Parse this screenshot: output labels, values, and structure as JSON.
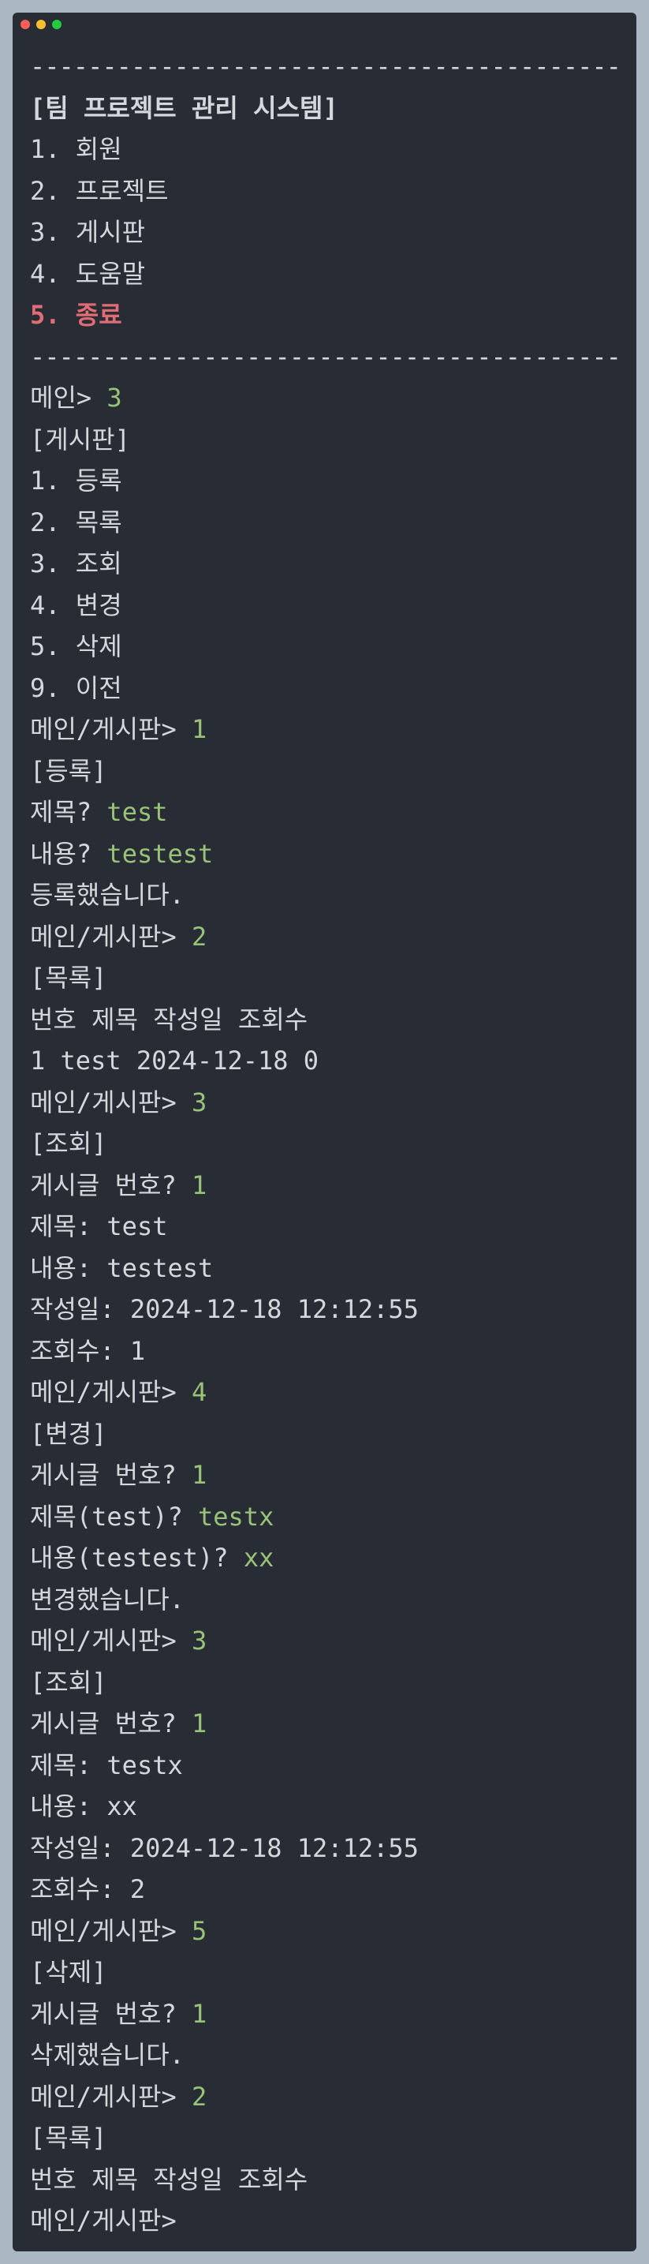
{
  "window": {
    "buttons": {
      "close_color": "#ff5f56",
      "minimize_color": "#ffbd2e",
      "maximize_color": "#27c93f"
    }
  },
  "colors": {
    "text": "#d4d7dc",
    "input": "#98c379",
    "exit": "#e06c75",
    "background": "#282c34"
  },
  "lines": [
    {
      "kind": "sep",
      "text": "--------------------------------------------"
    },
    {
      "kind": "title",
      "text": "[팀 프로젝트 관리 시스템]"
    },
    {
      "kind": "text",
      "text": "1. 회원"
    },
    {
      "kind": "text",
      "text": "2. 프로젝트"
    },
    {
      "kind": "text",
      "text": "3. 게시판"
    },
    {
      "kind": "text",
      "text": "4. 도움말"
    },
    {
      "kind": "exit",
      "text": "5. 종료"
    },
    {
      "kind": "sep",
      "text": "--------------------------------------------"
    },
    {
      "kind": "prompt",
      "prompt": "메인> ",
      "input": "3"
    },
    {
      "kind": "text",
      "text": "[게시판]"
    },
    {
      "kind": "text",
      "text": "1. 등록"
    },
    {
      "kind": "text",
      "text": "2. 목록"
    },
    {
      "kind": "text",
      "text": "3. 조회"
    },
    {
      "kind": "text",
      "text": "4. 변경"
    },
    {
      "kind": "text",
      "text": "5. 삭제"
    },
    {
      "kind": "text",
      "text": "9. 이전"
    },
    {
      "kind": "prompt",
      "prompt": "메인/게시판> ",
      "input": "1"
    },
    {
      "kind": "text",
      "text": "[등록]"
    },
    {
      "kind": "prompt",
      "prompt": "제목? ",
      "input": "test"
    },
    {
      "kind": "prompt",
      "prompt": "내용? ",
      "input": "testest"
    },
    {
      "kind": "text",
      "text": "등록했습니다."
    },
    {
      "kind": "prompt",
      "prompt": "메인/게시판> ",
      "input": "2"
    },
    {
      "kind": "text",
      "text": "[목록]"
    },
    {
      "kind": "text",
      "text": "번호 제목 작성일 조회수"
    },
    {
      "kind": "text",
      "text": "1 test 2024-12-18 0"
    },
    {
      "kind": "prompt",
      "prompt": "메인/게시판> ",
      "input": "3"
    },
    {
      "kind": "text",
      "text": "[조회]"
    },
    {
      "kind": "prompt",
      "prompt": "게시글 번호? ",
      "input": "1"
    },
    {
      "kind": "text",
      "text": "제목: test"
    },
    {
      "kind": "text",
      "text": "내용: testest"
    },
    {
      "kind": "text",
      "text": "작성일: 2024-12-18 12:12:55"
    },
    {
      "kind": "text",
      "text": "조회수: 1"
    },
    {
      "kind": "prompt",
      "prompt": "메인/게시판> ",
      "input": "4"
    },
    {
      "kind": "text",
      "text": "[변경]"
    },
    {
      "kind": "prompt",
      "prompt": "게시글 번호? ",
      "input": "1"
    },
    {
      "kind": "prompt",
      "prompt": "제목(test)? ",
      "input": "testx"
    },
    {
      "kind": "prompt",
      "prompt": "내용(testest)? ",
      "input": "xx"
    },
    {
      "kind": "text",
      "text": "변경했습니다."
    },
    {
      "kind": "prompt",
      "prompt": "메인/게시판> ",
      "input": "3"
    },
    {
      "kind": "text",
      "text": "[조회]"
    },
    {
      "kind": "prompt",
      "prompt": "게시글 번호? ",
      "input": "1"
    },
    {
      "kind": "text",
      "text": "제목: testx"
    },
    {
      "kind": "text",
      "text": "내용: xx"
    },
    {
      "kind": "text",
      "text": "작성일: 2024-12-18 12:12:55"
    },
    {
      "kind": "text",
      "text": "조회수: 2"
    },
    {
      "kind": "prompt",
      "prompt": "메인/게시판> ",
      "input": "5"
    },
    {
      "kind": "text",
      "text": "[삭제]"
    },
    {
      "kind": "prompt",
      "prompt": "게시글 번호? ",
      "input": "1"
    },
    {
      "kind": "text",
      "text": "삭제했습니다."
    },
    {
      "kind": "prompt",
      "prompt": "메인/게시판> ",
      "input": "2"
    },
    {
      "kind": "text",
      "text": "[목록]"
    },
    {
      "kind": "text",
      "text": "번호 제목 작성일 조회수"
    },
    {
      "kind": "prompt",
      "prompt": "메인/게시판>",
      "input": ""
    }
  ]
}
